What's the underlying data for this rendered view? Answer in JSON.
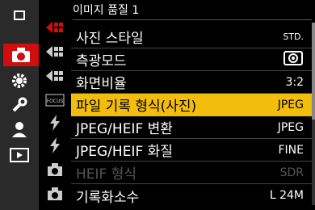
{
  "menu": {
    "title": "이미지 품질 1",
    "items": [
      {
        "label": "사진 스타일",
        "value": "STD."
      },
      {
        "label": "측광모드",
        "value": "(◉)"
      },
      {
        "label": "화면비율",
        "value": "3:2"
      },
      {
        "label": "파일 기록 형식(사진)",
        "value": "JPEG"
      },
      {
        "label": "JPEG/HEIF 변환",
        "value": "JPEG"
      },
      {
        "label": "JPEG/HEIF 화질",
        "value": "FINE"
      },
      {
        "label": "HEIF 형식",
        "value": "SDR"
      },
      {
        "label": "기록화소수",
        "value": "L 24M"
      }
    ]
  },
  "colors": {
    "accent": "#d10e0e",
    "highlight": "#f2bd0c"
  }
}
